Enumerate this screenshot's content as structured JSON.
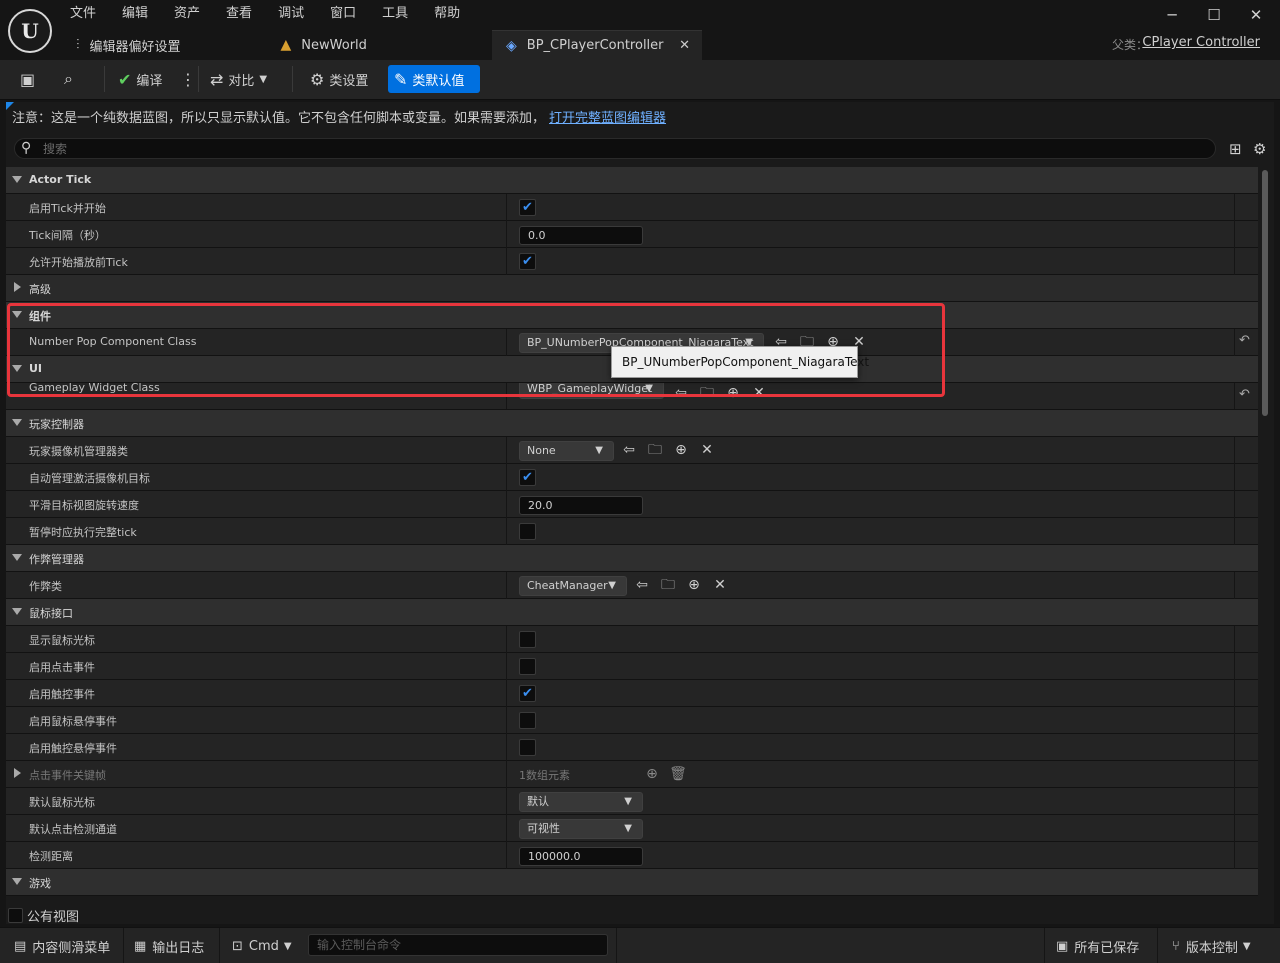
{
  "window": {
    "menu": [
      "文件",
      "编辑",
      "资产",
      "查看",
      "调试",
      "窗口",
      "工具",
      "帮助"
    ],
    "tabs": [
      {
        "label": "编辑器偏好设置",
        "icon": "sliders-icon"
      },
      {
        "label": "NewWorld",
        "icon": "level-icon"
      },
      {
        "label": "BP_CPlayerController",
        "icon": "gamepad-icon",
        "active": true
      }
    ],
    "parent_label": "父类：",
    "parent_class": "CPlayer Controller"
  },
  "toolbar": {
    "compile": "编译",
    "diff": "对比",
    "class_settings": "类设置",
    "class_defaults": "类默认值"
  },
  "notice": {
    "text": "注意：这是一个纯数据蓝图，所以只显示默认值。它不包含任何脚本或变量。如果需要添加，",
    "link": "打开完整蓝图编辑器"
  },
  "search": {
    "placeholder": "搜索"
  },
  "details": {
    "actor_tick": {
      "title": "Actor Tick",
      "start_with_tick": {
        "label": "启用Tick并开始",
        "checked": true
      },
      "tick_interval": {
        "label": "Tick间隔（秒）",
        "value": "0.0"
      },
      "tick_before_begin": {
        "label": "允许开始播放前Tick",
        "checked": true
      },
      "advanced": "高级"
    },
    "components": {
      "title": "组件",
      "number_pop": {
        "label": "Number Pop Component Class",
        "value": "BP_UNumberPopComponent_NiagaraText"
      },
      "tooltip": "BP_UNumberPopComponent_NiagaraText"
    },
    "ui": {
      "title": "UI",
      "gameplay_widget": {
        "label": "Gameplay Widget Class",
        "value": "WBP_GameplayWidget"
      }
    },
    "player_controller": {
      "title": "玩家控制器",
      "camera_manager": {
        "label": "玩家摄像机管理器类",
        "value": "None"
      },
      "auto_manage_camera": {
        "label": "自动管理激活摄像机目标",
        "checked": true
      },
      "smooth_rotation": {
        "label": "平滑目标视图旋转速度",
        "value": "20.0"
      },
      "pause_tick": {
        "label": "暂停时应执行完整tick",
        "checked": false
      }
    },
    "cheat_manager": {
      "title": "作弊管理器",
      "cheat_class": {
        "label": "作弊类",
        "value": "CheatManager"
      }
    },
    "mouse_interface": {
      "title": "鼠标接口",
      "show_cursor": {
        "label": "显示鼠标光标",
        "checked": false
      },
      "click_events": {
        "label": "启用点击事件",
        "checked": false
      },
      "touch_events": {
        "label": "启用触控事件",
        "checked": true
      },
      "mouse_over_events": {
        "label": "启用鼠标悬停事件",
        "checked": false
      },
      "touch_over_events": {
        "label": "启用触控悬停事件",
        "checked": false
      },
      "click_keys": {
        "label": "点击事件关键帧",
        "value": "1数组元素"
      },
      "default_cursor": {
        "label": "默认鼠标光标",
        "value": "默认"
      },
      "click_trace": {
        "label": "默认点击检测通道",
        "value": "可视性"
      },
      "hit_distance": {
        "label": "检测距离",
        "value": "100000.0"
      }
    },
    "game": {
      "title": "游戏"
    }
  },
  "public_view": "公有视图",
  "statusbar": {
    "content_drawer": "内容侧滑菜单",
    "output_log": "输出日志",
    "cmd": "Cmd",
    "console_placeholder": "输入控制台命令",
    "all_saved": "所有已保存",
    "source_control": "版本控制"
  }
}
